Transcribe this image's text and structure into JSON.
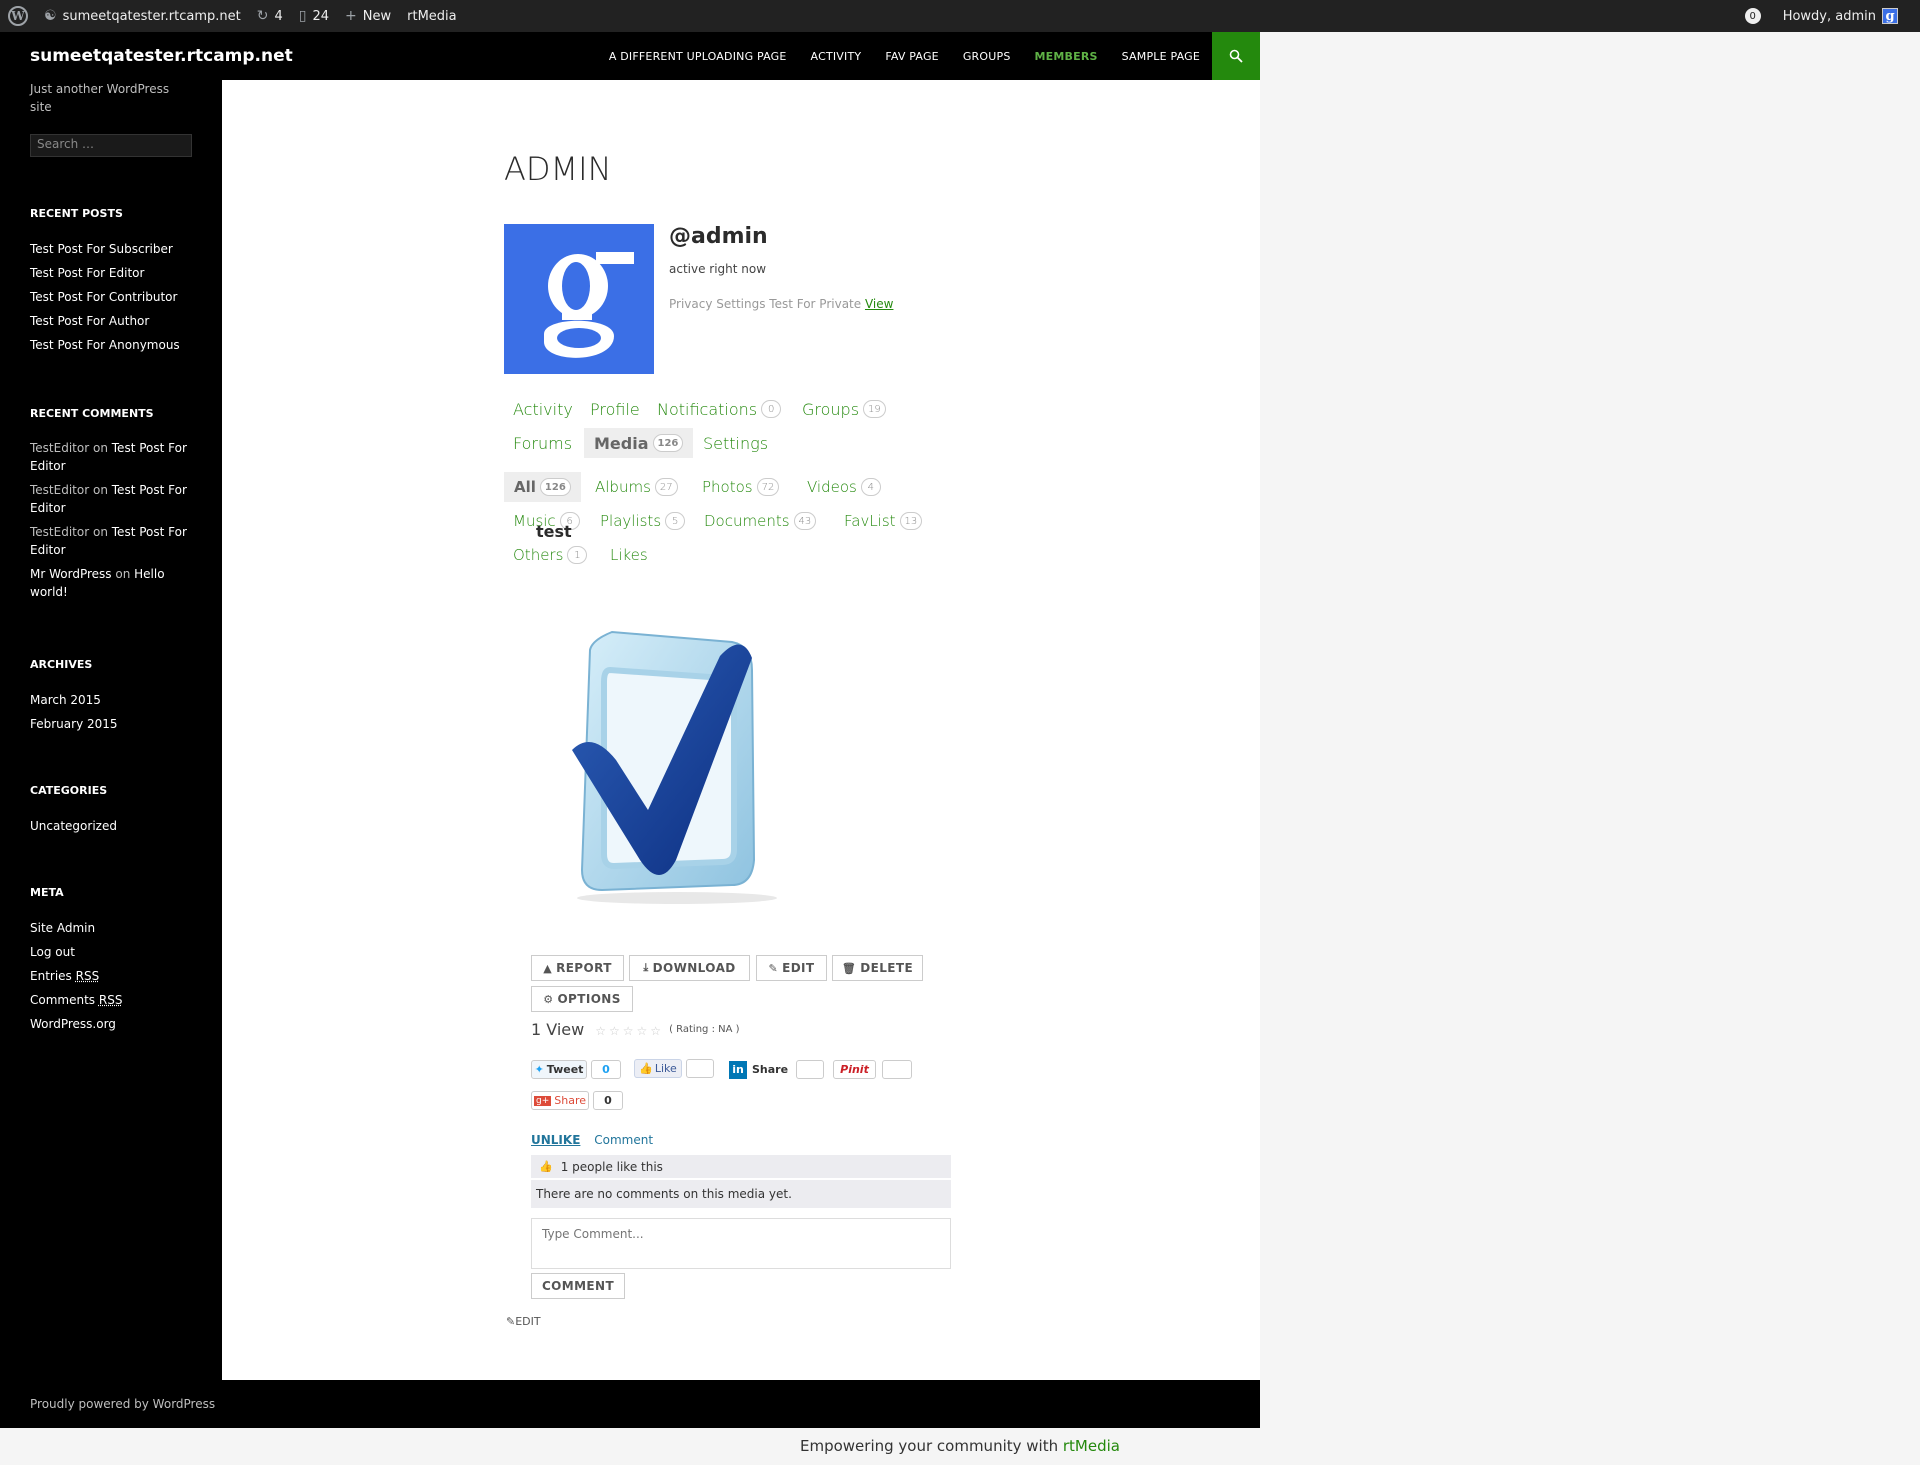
{
  "adminbar": {
    "site": "sumeetqatester.rtcamp.net",
    "updates": "4",
    "comments": "24",
    "new": "New",
    "rtmedia": "rtMedia",
    "notif_count": "0",
    "howdy": "Howdy, admin"
  },
  "header": {
    "site_title": "sumeetqatester.rtcamp.net",
    "nav": [
      "A DIFFERENT UPLOADING PAGE",
      "ACTIVITY",
      "FAV PAGE",
      "GROUPS",
      "MEMBERS",
      "SAMPLE PAGE"
    ]
  },
  "sidebar": {
    "description": "Just another WordPress site",
    "search_placeholder": "Search …",
    "recent_posts_title": "RECENT POSTS",
    "recent_posts": [
      "Test Post For Subscriber",
      "Test Post For Editor",
      "Test Post For Contributor",
      "Test Post For Author",
      "Test Post For Anonymous"
    ],
    "recent_comments_title": "RECENT COMMENTS",
    "recent_comments": [
      {
        "author": "TestEditor",
        "on": "on",
        "post": "Test Post For Editor"
      },
      {
        "author": "TestEditor",
        "on": "on",
        "post": "Test Post For Editor"
      },
      {
        "author": "TestEditor",
        "on": "on",
        "post": "Test Post For Editor"
      },
      {
        "author": "Mr WordPress",
        "on": "on",
        "post": "Hello world!"
      }
    ],
    "archives_title": "ARCHIVES",
    "archives": [
      "March 2015",
      "February 2015"
    ],
    "categories_title": "CATEGORIES",
    "categories": [
      "Uncategorized"
    ],
    "meta_title": "META",
    "meta": {
      "site_admin": "Site Admin",
      "log_out": "Log out",
      "entries": "Entries",
      "comments": "Comments",
      "rss": "RSS",
      "wordpress_org": "WordPress.org"
    }
  },
  "profile": {
    "page_title": "ADMIN",
    "username": "@admin",
    "activity": "active right now",
    "privacy_text": "Privacy Settings Test For Private",
    "privacy_link": "View"
  },
  "main_tabs": [
    {
      "label": "Activity"
    },
    {
      "label": "Profile"
    },
    {
      "label": "Notifications",
      "count": "0"
    },
    {
      "label": "Groups",
      "count": "19"
    },
    {
      "label": "Forums"
    },
    {
      "label": "Media",
      "count": "126"
    },
    {
      "label": "Settings"
    }
  ],
  "media_tabs": [
    {
      "label": "All",
      "count": "126"
    },
    {
      "label": "Albums",
      "count": "27"
    },
    {
      "label": "Photos",
      "count": "72"
    },
    {
      "label": "Videos",
      "count": "4"
    },
    {
      "label": "Music",
      "count": "6"
    },
    {
      "label": "Playlists",
      "count": "5"
    },
    {
      "label": "Documents",
      "count": "43"
    },
    {
      "label": "FavList",
      "count": "13"
    },
    {
      "label": "Others",
      "count": "1"
    },
    {
      "label": "Likes"
    }
  ],
  "media": {
    "title": "test",
    "buttons": {
      "report": "REPORT",
      "download": "DOWNLOAD",
      "edit": "EDIT",
      "delete": "DELETE",
      "options": "OPTIONS"
    },
    "views": "1 View",
    "rating_label": "( Rating : NA )",
    "social": {
      "tweet": "Tweet",
      "tweet_count": "0",
      "like": "Like",
      "share_in": "Share",
      "pinit": "Pinit",
      "gplus_share": "Share",
      "gplus_count": "0"
    },
    "unlike": "UNLIKE",
    "comment": "Comment",
    "likes_text": "1 people like this",
    "no_comments": "There are no comments on this media yet.",
    "comment_placeholder": "Type Comment...",
    "comment_button": "COMMENT",
    "edit": "EDIT"
  },
  "footer": {
    "powered": "Proudly powered by WordPress",
    "rtmedia_prefix": "Empowering your community with",
    "rtmedia_link": "rtMedia"
  },
  "colors": {
    "accent": "#24890d",
    "link_blue": "#21759b",
    "avatar_blue": "#3b6fe6"
  }
}
